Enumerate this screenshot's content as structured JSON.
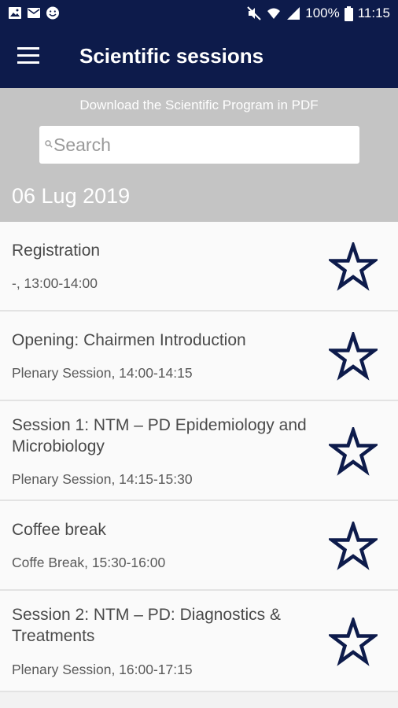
{
  "status_bar": {
    "battery": "100%",
    "time": "11:15",
    "left_icons": [
      "image-icon",
      "gallery-icon",
      "smiley-icon"
    ],
    "right_icons": [
      "mute-icon",
      "wifi-icon",
      "signal-icon",
      "battery-icon"
    ]
  },
  "app_bar": {
    "menu_icon": "hamburger-menu-icon",
    "title": "Scientific sessions"
  },
  "subheader": {
    "pdf_link": "Download the Scientific Program in PDF",
    "search_placeholder": "Search",
    "date": "06 Lug 2019"
  },
  "sessions": [
    {
      "title": "Registration",
      "meta": "-, 13:00-14:00",
      "favorited": false
    },
    {
      "title": "Opening: Chairmen Introduction",
      "meta": "Plenary Session, 14:00-14:15",
      "favorited": false
    },
    {
      "title": "Session 1: NTM – PD Epidemiology and Microbiology",
      "meta": "Plenary Session, 14:15-15:30",
      "favorited": false
    },
    {
      "title": "Coffee break",
      "meta": "Coffe Break, 15:30-16:00",
      "favorited": false
    },
    {
      "title": "Session 2: NTM – PD: Diagnostics & Treatments",
      "meta": "Plenary Session, 16:00-17:15",
      "favorited": false
    }
  ],
  "colors": {
    "primary": "#0d1b4b",
    "subheader_bg": "#c4c4c4",
    "list_bg": "#fafafa",
    "star_outline": "#0d1b4b"
  }
}
